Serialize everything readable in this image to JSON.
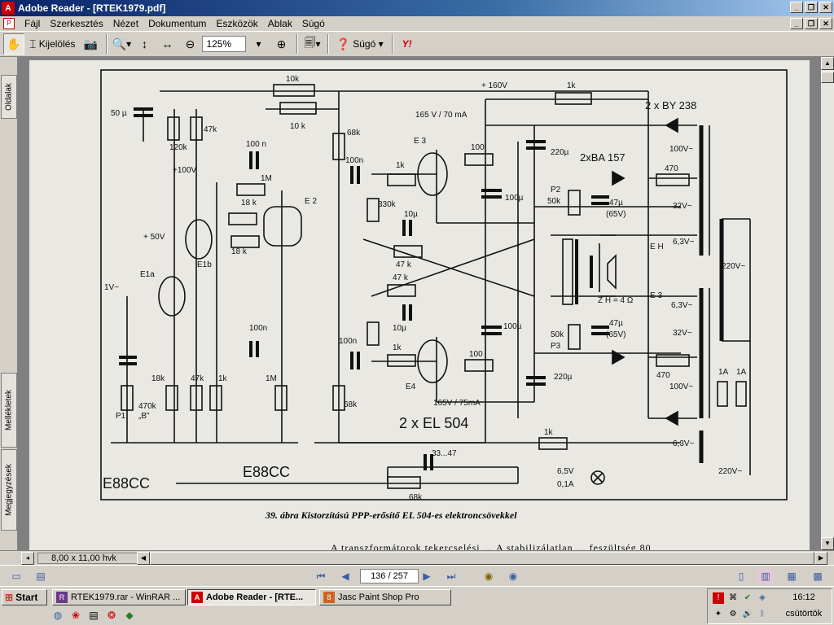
{
  "window": {
    "title": "Adobe Reader - [RTEK1979.pdf]",
    "app_icon": "adobe-reader-icon"
  },
  "menu": {
    "items": [
      "Fájl",
      "Szerkesztés",
      "Nézet",
      "Dokumentum",
      "Eszközök",
      "Ablak",
      "Súgó"
    ]
  },
  "toolbar": {
    "select_label": "Kijelölés",
    "zoom_value": "125%",
    "help_label": "Súgó"
  },
  "nav_tabs": {
    "pages": "Oldalak",
    "attachments": "Mellékletek",
    "comments": "Megjegyzések"
  },
  "document": {
    "caption": "39. ábra Kistorzítású PPP-erősítő EL 504-es elektroncsövekkel",
    "body_text": "A transzformátorok tekercselési ... A stabilizálatlan ... feszültség 80",
    "schematic_labels": {
      "r10k_top": "10k",
      "r10k_2": "10 k",
      "b160": "+ 160V",
      "r1k_top": "1k",
      "diode_by": "2 x BY 238",
      "c50u": "50 µ",
      "r120k": "120k",
      "r47k_a": "47k",
      "b100": "+100V",
      "c100n_a": "100 n",
      "r1m_a": "1M",
      "r68k_a": "68k",
      "e3_rating": "165 V / 70 mA",
      "e3": "E 3",
      "c220u_a": "220µ",
      "diode_ba": "2xBA 157",
      "r100n_b": "100n",
      "r1k_b": "1k",
      "r100_a": "100",
      "r470_a": "470",
      "v100_a": "100V~",
      "r18k_a": "18 k",
      "e2": "E 2",
      "r330k": "330k",
      "c10u_a": "10µ",
      "c100u_a": "100µ",
      "p2": "P2",
      "r50k_a": "50k",
      "c47u_a": "47µ",
      "v65_a": "(65V)",
      "v32_a": "32V~",
      "b50": "+ 50V",
      "r18k_b": "18 k",
      "e1b": "E1b",
      "r47k_b": "47 k",
      "eh": "E H",
      "v63_a": "6,3V~",
      "e1a": "E1a",
      "v1": "1V~",
      "r47k_c": "47 k",
      "zh": "Z H = 4 Ω",
      "v220_a": "220V~",
      "e3b": "E 3",
      "v63_b": "6,3V~",
      "c10u_b": "10µ",
      "c100u_b": "100µ",
      "r50k_b": "50k",
      "p3": "P3",
      "c47u_b": "47µ",
      "v65_b": "(65V)",
      "v32_b": "32V~",
      "c100n_c": "100n",
      "r100n_d": "100n",
      "r1k_c": "1k",
      "r100_b": "100",
      "r470_b": "470",
      "r18k_c": "18k",
      "r47k_d": "47k",
      "r1k_d": "1k",
      "r1m_b": "1M",
      "p1": "P1",
      "r470k": "470k",
      "ban": "„B\"",
      "e4": "E4",
      "c220u_b": "220µ",
      "v100_b": "100V~",
      "r68k_b": "68k",
      "e4_rating": "165V / 75mA",
      "tubes": "2 x EL 504",
      "fuse1": "1A",
      "fuse2": "1A",
      "r1k_e": "1k",
      "v63_c": "6,3V~",
      "c33": "33...47",
      "e88cc_a": "E88CC",
      "e88cc_b": "E88CC",
      "lamp_v": "6,5V",
      "lamp_a": "0,1A",
      "v220_b": "220V~",
      "r68k_c": "68k"
    }
  },
  "status": {
    "page_size": "8,00 x 11,00 hvk",
    "page_indicator": "136 / 257"
  },
  "taskbar": {
    "start_label": "Start",
    "tasks": [
      "RTEK1979.rar - WinRAR ...",
      "Adobe Reader - [RTE...",
      "Jasc Paint Shop Pro"
    ],
    "clock": "16:12",
    "day": "csütörtök"
  }
}
